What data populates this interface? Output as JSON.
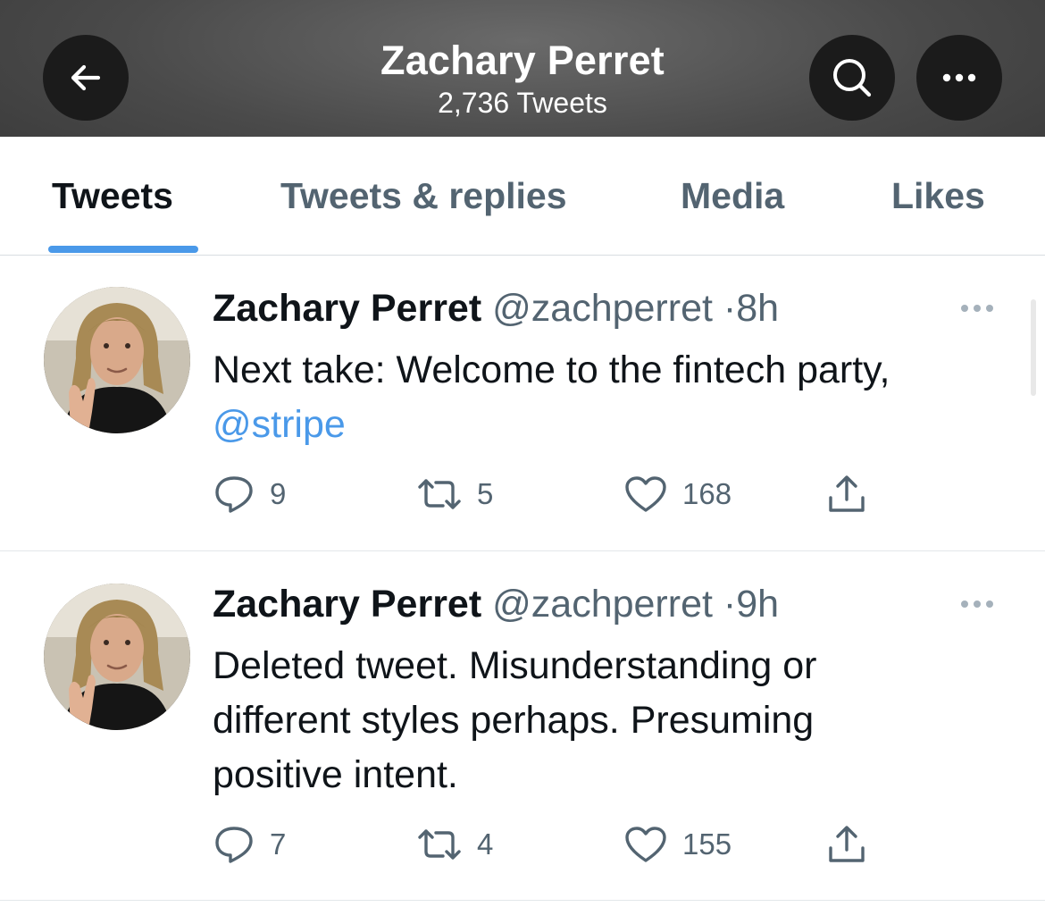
{
  "header": {
    "title": "Zachary Perret",
    "subtitle": "2,736 Tweets",
    "icons": [
      "arrow-left-icon",
      "search-icon",
      "ellipsis-icon"
    ]
  },
  "tabs": [
    {
      "label": "Tweets",
      "active": true
    },
    {
      "label": "Tweets & replies",
      "active": false
    },
    {
      "label": "Media",
      "active": false
    },
    {
      "label": "Likes",
      "active": false
    }
  ],
  "colors": {
    "accent": "#4a99e9",
    "text_primary": "#0f1419",
    "text_secondary": "#536471"
  },
  "tweets": [
    {
      "name": "Zachary Perret",
      "handle": "@zachperret",
      "dot": "·",
      "time": "8h",
      "text": "Next take: Welcome to the fintech party,",
      "mention": "@stripe",
      "replies": "9",
      "retweets": "5",
      "likes": "168"
    },
    {
      "name": "Zachary Perret",
      "handle": "@zachperret",
      "dot": "·",
      "time": "9h",
      "text": "Deleted tweet. Misunderstanding or different styles perhaps. Presuming positive intent.",
      "replies": "7",
      "retweets": "4",
      "likes": "155"
    }
  ]
}
